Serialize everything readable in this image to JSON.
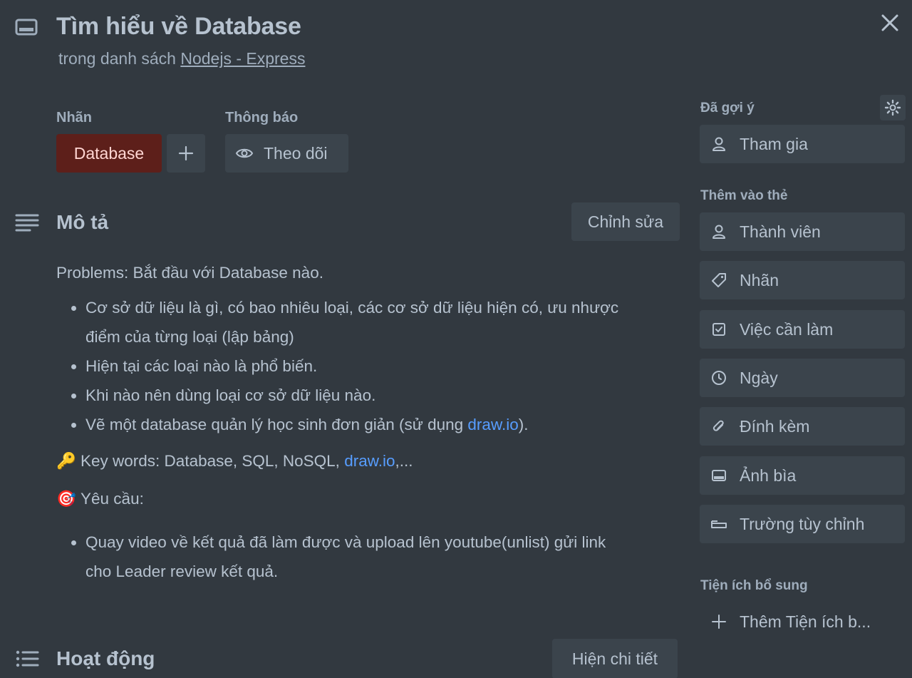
{
  "card": {
    "title": "Tìm hiểu về Database",
    "list_prefix": "trong danh sách",
    "list_name": "Nodejs - Express"
  },
  "labels": {
    "heading": "Nhãn",
    "items": [
      "Database"
    ],
    "label_color": "#5d1f1a"
  },
  "notifications": {
    "heading": "Thông báo",
    "watch_label": "Theo dõi"
  },
  "description": {
    "heading": "Mô tả",
    "edit_label": "Chỉnh sửa",
    "problems": "Problems: Bắt đầu với Database nào.",
    "bullets": [
      "Cơ sở dữ liệu là gì, có bao nhiêu loại, các cơ sở dữ liệu hiện có, ưu nhược",
      "điểm của từng loại (lập bảng)",
      "Hiện tại các loại nào là phổ biến.",
      "Khi nào nên dùng loại cơ sở dữ liệu nào.",
      "Vẽ một database quản lý học sinh đơn giản (sử dụng ",
      "draw.io",
      ")."
    ],
    "keywords_emoji": "🔑",
    "keywords_text": "Key words: Database, SQL, NoSQL, ",
    "keywords_link": "draw.io",
    "keywords_tail": ",...",
    "requirements_emoji": "🎯",
    "requirements_heading": "Yêu cầu:",
    "requirement_line1": "Quay video về kết quả đã làm được và upload lên youtube(unlist) gửi link",
    "requirement_line2": "cho Leader review kết quả."
  },
  "activity": {
    "heading": "Hoạt động",
    "details_label": "Hiện chi tiết"
  },
  "sidebar": {
    "suggested_heading": "Đã gợi ý",
    "join_label": "Tham gia",
    "add_to_card_heading": "Thêm vào thẻ",
    "items": [
      {
        "label": "Thành viên",
        "icon": "person-icon"
      },
      {
        "label": "Nhãn",
        "icon": "tag-icon"
      },
      {
        "label": "Việc cần làm",
        "icon": "checklist-icon"
      },
      {
        "label": "Ngày",
        "icon": "clock-icon"
      },
      {
        "label": "Đính kèm",
        "icon": "paperclip-icon"
      },
      {
        "label": "Ảnh bìa",
        "icon": "cover-icon"
      },
      {
        "label": "Trường tùy chỉnh",
        "icon": "custom-field-icon"
      }
    ],
    "powerups_heading": "Tiện ích bổ sung",
    "add_powerup_label": "Thêm Tiện ích b..."
  },
  "colors": {
    "background": "#323940",
    "button": "#3b444c",
    "link": "#579dff"
  }
}
